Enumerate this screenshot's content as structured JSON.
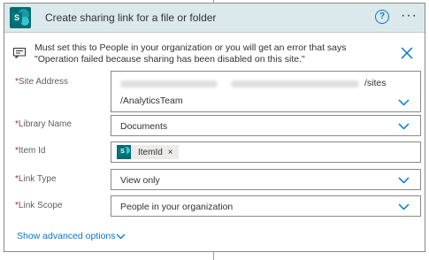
{
  "card": {
    "title": "Create sharing link for a file or folder",
    "note": "Must set this to People in your organization or you will get an error that says \"Operation failed because sharing has been disabled on this site.\""
  },
  "fields": {
    "site_address": {
      "label": "Site Address",
      "required_mark": "*",
      "value_suffix": "/sites",
      "value_line2": "/AnalyticsTeam"
    },
    "library_name": {
      "label": "Library Name",
      "required_mark": "*",
      "value": "Documents"
    },
    "item_id": {
      "label": "Item Id",
      "required_mark": "*",
      "token": "ItemId",
      "token_remove": "×"
    },
    "link_type": {
      "label": "Link Type",
      "required_mark": "*",
      "value": "View only"
    },
    "link_scope": {
      "label": "Link Scope",
      "required_mark": "*",
      "value": "People in your organization"
    }
  },
  "advanced_options": "Show advanced options",
  "colors": {
    "accent": "#0078d4",
    "header_bg": "#dbe9ec",
    "sharepoint": "#036c70",
    "required": "#a4262c"
  },
  "icons": [
    "sharepoint-logo-icon",
    "help-icon",
    "more-icon",
    "note-icon",
    "close-icon",
    "chevron-down-icon"
  ]
}
